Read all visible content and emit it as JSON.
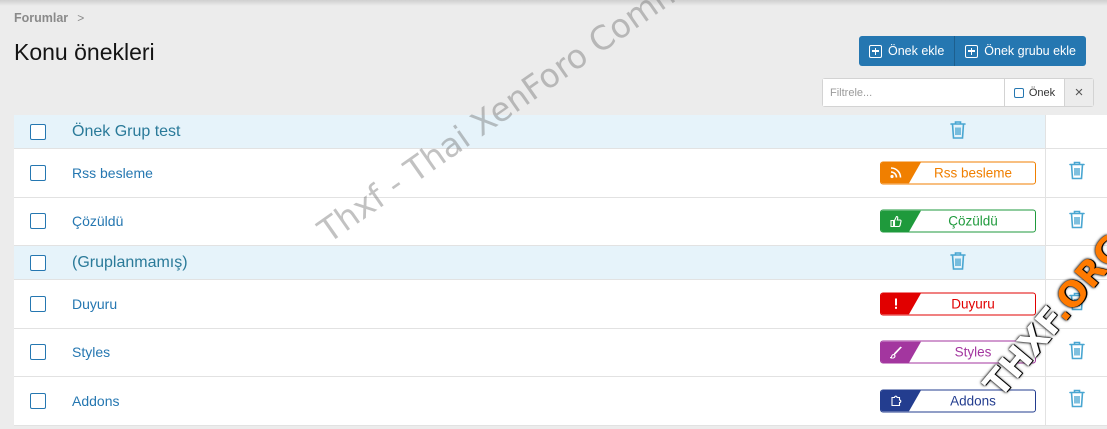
{
  "breadcrumb": {
    "item": "Forumlar",
    "separator": ">"
  },
  "page_title": "Konu önekleri",
  "actions": {
    "add_prefix": "Önek ekle",
    "add_prefix_group": "Önek grubu ekle"
  },
  "filter": {
    "placeholder": "Filtrele...",
    "prefix_toggle": "Önek",
    "clear": "×"
  },
  "rows": [
    {
      "type": "group",
      "label": "Önek Grup test"
    },
    {
      "type": "item",
      "label": "Rss besleme",
      "badge": {
        "text": "Rss besleme",
        "color": "#f07f00",
        "icon": "rss-icon"
      }
    },
    {
      "type": "item",
      "label": "Çözüldü",
      "badge": {
        "text": "Çözüldü",
        "color": "#1f9a3c",
        "icon": "thumbs-up-icon"
      }
    },
    {
      "type": "group",
      "label": "(Gruplanmamış)"
    },
    {
      "type": "item",
      "label": "Duyuru",
      "badge": {
        "text": "Duyuru",
        "color": "#e10000",
        "icon": "exclamation-icon"
      }
    },
    {
      "type": "item",
      "label": "Styles",
      "badge": {
        "text": "Styles",
        "color": "#a3369f",
        "icon": "paintbrush-icon"
      }
    },
    {
      "type": "item",
      "label": "Addons",
      "badge": {
        "text": "Addons",
        "color": "#233d8f",
        "icon": "puzzle-icon"
      }
    }
  ],
  "watermark": "Thxf - Thai XenForo Community",
  "logo": {
    "part1": "THXF",
    "part2": ".ORG"
  },
  "colors": {
    "accent": "#2577b1",
    "group_bg": "#e6f3fa",
    "page_bg": "#ececec"
  }
}
